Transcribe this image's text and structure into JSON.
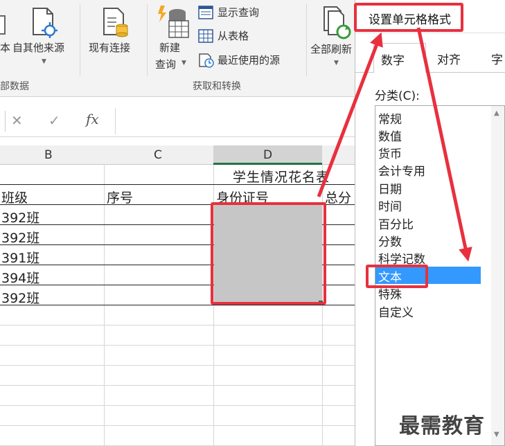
{
  "ribbon": {
    "btn_text_partial": "本",
    "btn_other_sources": "自其他来源",
    "btn_existing_connections": "现有连接",
    "btn_new_query": "新建",
    "btn_new_query_2": "查询",
    "btn_show_queries": "显示查询",
    "btn_from_table": "从表格",
    "btn_recent_sources": "最近使用的源",
    "btn_refresh_all": "全部刷新",
    "group_external_data": "部数据",
    "group_get_transform": "获取和转换"
  },
  "formula_bar": {
    "cancel": "✕",
    "enter": "✓",
    "fx": "fx"
  },
  "columns": [
    "B",
    "C",
    "D"
  ],
  "sheet": {
    "title_cell": "学生情况花名表",
    "headers": [
      "班级",
      "序号",
      "身份证号",
      "总分"
    ],
    "class_values": [
      "392班",
      "392班",
      "391班",
      "394班",
      "392班"
    ]
  },
  "dialog": {
    "title": "设置单元格格式",
    "tabs": [
      "数字",
      "对齐",
      "字"
    ],
    "category_label": "分类(C):",
    "categories": [
      "常规",
      "数值",
      "货币",
      "会计专用",
      "日期",
      "时间",
      "百分比",
      "分数",
      "科学记数",
      "文本",
      "特殊",
      "自定义"
    ],
    "selected_category": "文本"
  },
  "watermark": "最需教育",
  "colors": {
    "annotation_red": "#e8303e",
    "selection_blue": "#3399ff",
    "selected_range_gray": "#c6c6c6"
  }
}
